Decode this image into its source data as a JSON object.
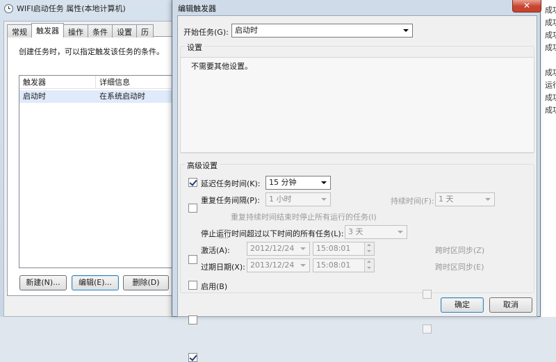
{
  "back_window": {
    "title": "WIFI启动任务 属性(本地计算机)",
    "tabs": [
      "常规",
      "触发器",
      "操作",
      "条件",
      "设置",
      "历"
    ],
    "active_tab": "触发器",
    "description": "创建任务时，可以指定触发该任务的条件。",
    "table": {
      "columns": [
        "触发器",
        "详细信息"
      ],
      "rows": [
        {
          "trigger": "启动时",
          "detail": "在系统启动时"
        }
      ]
    },
    "buttons": {
      "new": "新建(N)...",
      "edit": "编辑(E)...",
      "delete": "删除(D)"
    }
  },
  "right_strip": [
    "成功",
    "成功",
    "成功",
    "成功",
    "成功",
    "运行",
    "成功",
    "成功"
  ],
  "dialog": {
    "title": "编辑触发器",
    "close_glyph": "✕",
    "start_task_label": "开始任务(G):",
    "start_task_value": "启动时",
    "settings_title": "设置",
    "settings_text": "不需要其他设置。",
    "advanced_title": "高级设置",
    "delay": {
      "label": "延迟任务时间(K):",
      "checked": true,
      "value": "15 分钟"
    },
    "repeat": {
      "label": "重复任务间隔(P):",
      "checked": false,
      "value": "1 小时",
      "duration_label": "持续时间(F):",
      "duration_value": "1 天",
      "stop_label": "重复持续时间结束时停止所有运行的任务(I)"
    },
    "stop_longer": {
      "label": "停止运行时间超过以下时间的所有任务(L):",
      "checked": false,
      "value": "3 天"
    },
    "activate": {
      "label": "激活(A):",
      "checked": false,
      "date": "2012/12/24",
      "time": "15:08:01",
      "sync_label": "跨时区同步(Z)"
    },
    "expire": {
      "label": "过期日期(X):",
      "checked": false,
      "date": "2013/12/24",
      "time": "15:08:01",
      "sync_label": "跨时区同步(E)"
    },
    "enabled": {
      "label": "启用(B)",
      "checked": true
    },
    "ok_label": "确定",
    "cancel_label": "取消"
  }
}
